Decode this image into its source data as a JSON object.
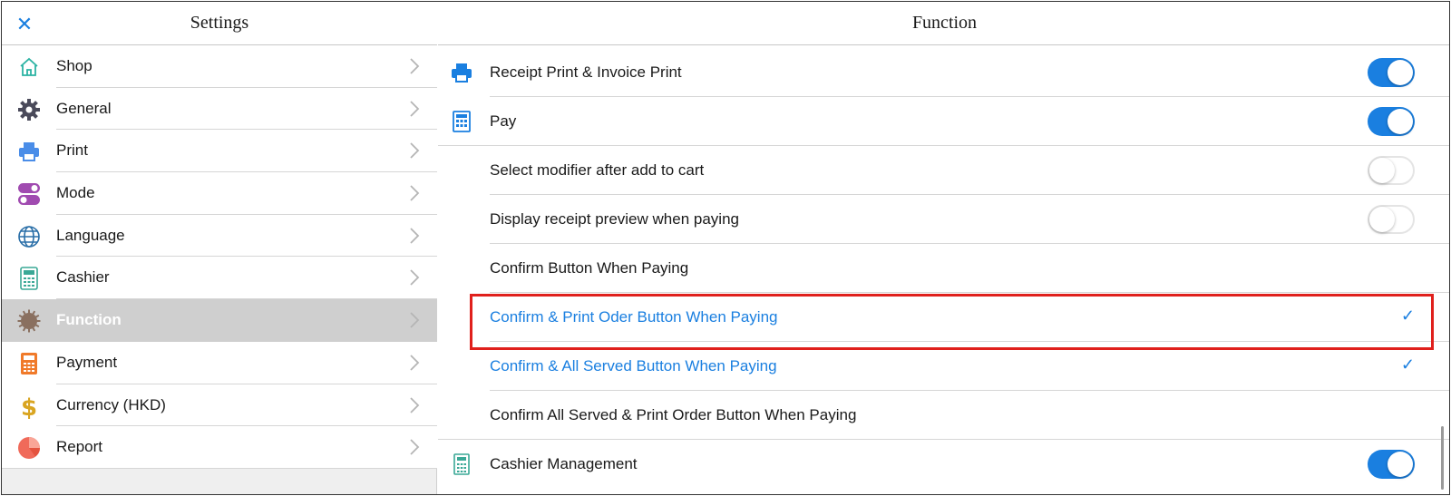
{
  "left_panel": {
    "title": "Settings",
    "close_icon": "close-icon",
    "items": [
      {
        "label": "Shop",
        "icon": "shop-icon"
      },
      {
        "label": "General",
        "icon": "gear-icon"
      },
      {
        "label": "Print",
        "icon": "printer-icon"
      },
      {
        "label": "Mode",
        "icon": "mode-toggle-icon"
      },
      {
        "label": "Language",
        "icon": "globe-icon"
      },
      {
        "label": "Cashier",
        "icon": "cashier-icon"
      },
      {
        "label": "Function",
        "icon": "function-gear-icon",
        "active": true
      },
      {
        "label": "Payment",
        "icon": "calculator-icon"
      },
      {
        "label": "Currency (HKD)",
        "icon": "dollar-icon"
      },
      {
        "label": "Report",
        "icon": "pie-chart-icon"
      }
    ]
  },
  "right_panel": {
    "title": "Function",
    "rows": [
      {
        "label": "Receipt Print & Invoice Print",
        "icon": "printer-icon",
        "toggle": "on"
      },
      {
        "label": "Pay",
        "icon": "calculator-icon",
        "toggle": "on"
      },
      {
        "label": "Select modifier after add to cart",
        "toggle": "off"
      },
      {
        "label": "Display receipt preview when paying",
        "toggle": "off"
      },
      {
        "label": "Confirm Button When Paying"
      },
      {
        "label": "Confirm & Print Oder Button When Paying",
        "checked": true,
        "highlighted": true
      },
      {
        "label": "Confirm & All Served Button When Paying",
        "checked": true
      },
      {
        "label": "Confirm All Served & Print Order Button When Paying"
      },
      {
        "label": "Cashier Management",
        "icon": "cashier-icon",
        "toggle": "on"
      }
    ],
    "check_glyph": "✓"
  },
  "colors": {
    "accent": "#1a7fe0",
    "highlight_border": "#e0201c",
    "active_row_bg": "#cfcfcf"
  }
}
